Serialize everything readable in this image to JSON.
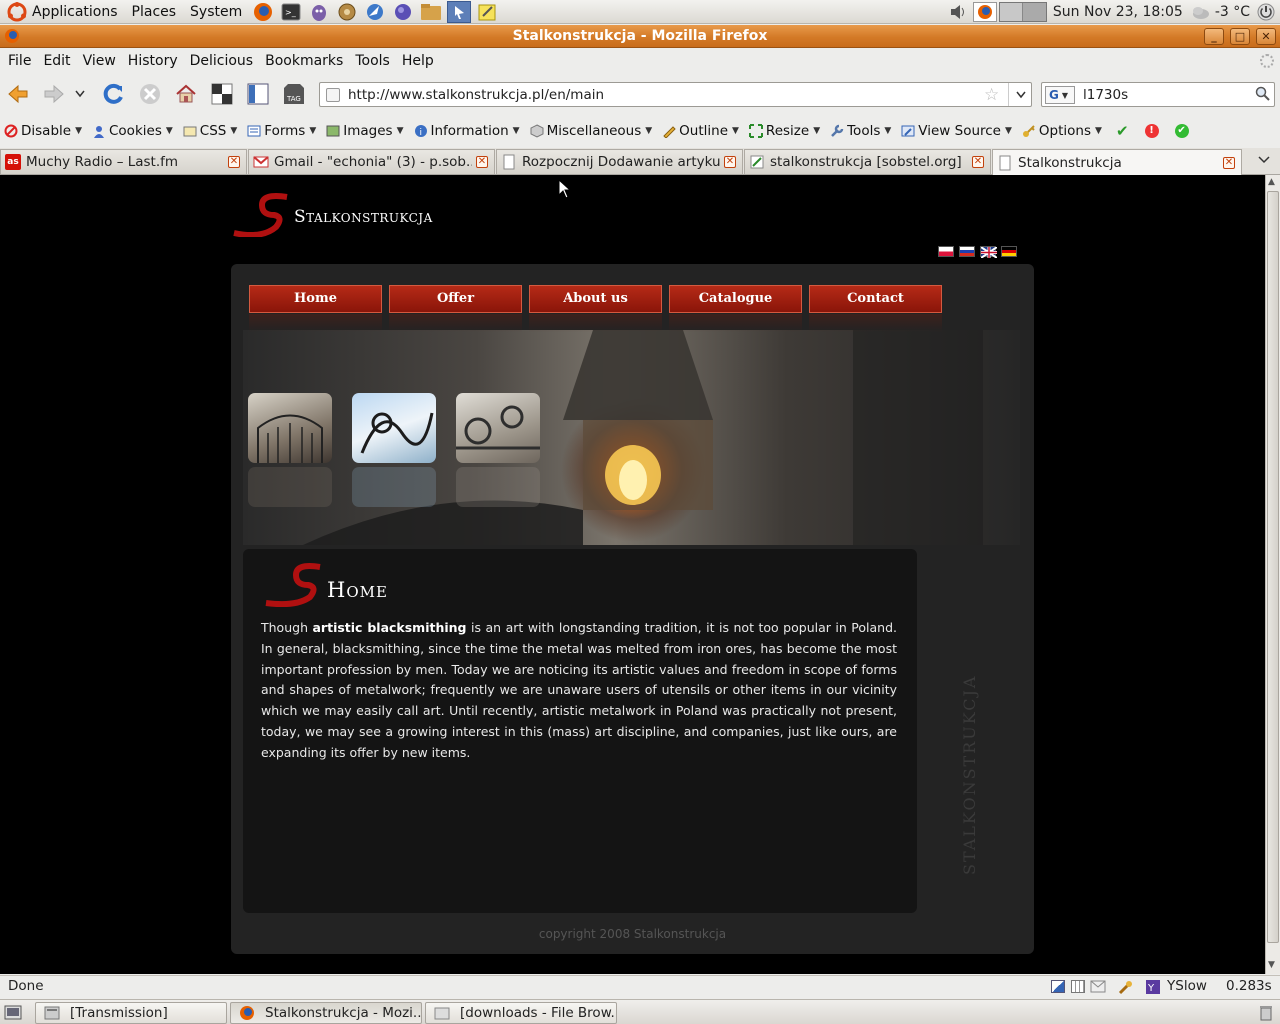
{
  "top_panel": {
    "menus": [
      "Applications",
      "Places",
      "System"
    ],
    "clock": "Sun Nov 23, 18:05",
    "weather": "-3 °C"
  },
  "window": {
    "title": "Stalkonstrukcja - Mozilla Firefox"
  },
  "menubar": [
    "File",
    "Edit",
    "View",
    "History",
    "Delicious",
    "Bookmarks",
    "Tools",
    "Help"
  ],
  "navigation": {
    "url": "http://www.stalkonstrukcja.pl/en/main",
    "search_value": "l1730s"
  },
  "devbar": [
    "Disable",
    "Cookies",
    "CSS",
    "Forms",
    "Images",
    "Information",
    "Miscellaneous",
    "Outline",
    "Resize",
    "Tools",
    "View Source",
    "Options"
  ],
  "tabs": [
    {
      "label": "Muchy Radio – Last.fm",
      "favicon": "lastfm-icon"
    },
    {
      "label": "Gmail - \"echonia\" (3) - p.sob...",
      "favicon": "gmail-icon"
    },
    {
      "label": "Rozpocznij Dodawanie artyku...",
      "favicon": "page-icon"
    },
    {
      "label": "stalkonstrukcja [sobstel.org]",
      "favicon": "edit-icon"
    },
    {
      "label": "Stalkonstrukcja",
      "favicon": "page-icon",
      "active": true
    }
  ],
  "site": {
    "logo_text": "Stalkonstrukcja",
    "nav": [
      "Home",
      "Offer",
      "About us",
      "Catalogue",
      "Contact"
    ],
    "heading": "Home",
    "body_pre": "Though ",
    "body_bold": "artistic blacksmithing",
    "body_post": " is an art with longstanding tradition, it is not too popular in Poland. In general, blacksmithing, since the time the metal was melted from iron ores, has become the most important profession by men. Today we are noticing its artistic values and freedom in scope of forms and shapes of metalwork; frequently we are unaware users of utensils or other items in our vicinity which we may easily call art. Until recently, artistic metalwork in Poland was practically not present, today, we may see a growing interest in this (mass) art discipline, and companies, just like ours, are expanding its offer by new items.",
    "copyright": "copyright 2008  Stalkonstrukcja",
    "side_watermark": "STALKONSTRUKCJA"
  },
  "statusbar": {
    "status": "Done",
    "yslow_label": "YSlow",
    "load_time": "0.283s"
  },
  "taskbar": [
    {
      "label": "[Transmission]",
      "icon": "transmission-icon"
    },
    {
      "label": "Stalkonstrukcja - Mozi...",
      "icon": "firefox-icon",
      "active": true
    },
    {
      "label": "[downloads - File Brow...",
      "icon": "folder-icon"
    }
  ],
  "colors": {
    "title_bar": "#d47a27",
    "site_nav": "#a0200f",
    "site_bg": "#000000",
    "tab_close": "#c2410c"
  }
}
